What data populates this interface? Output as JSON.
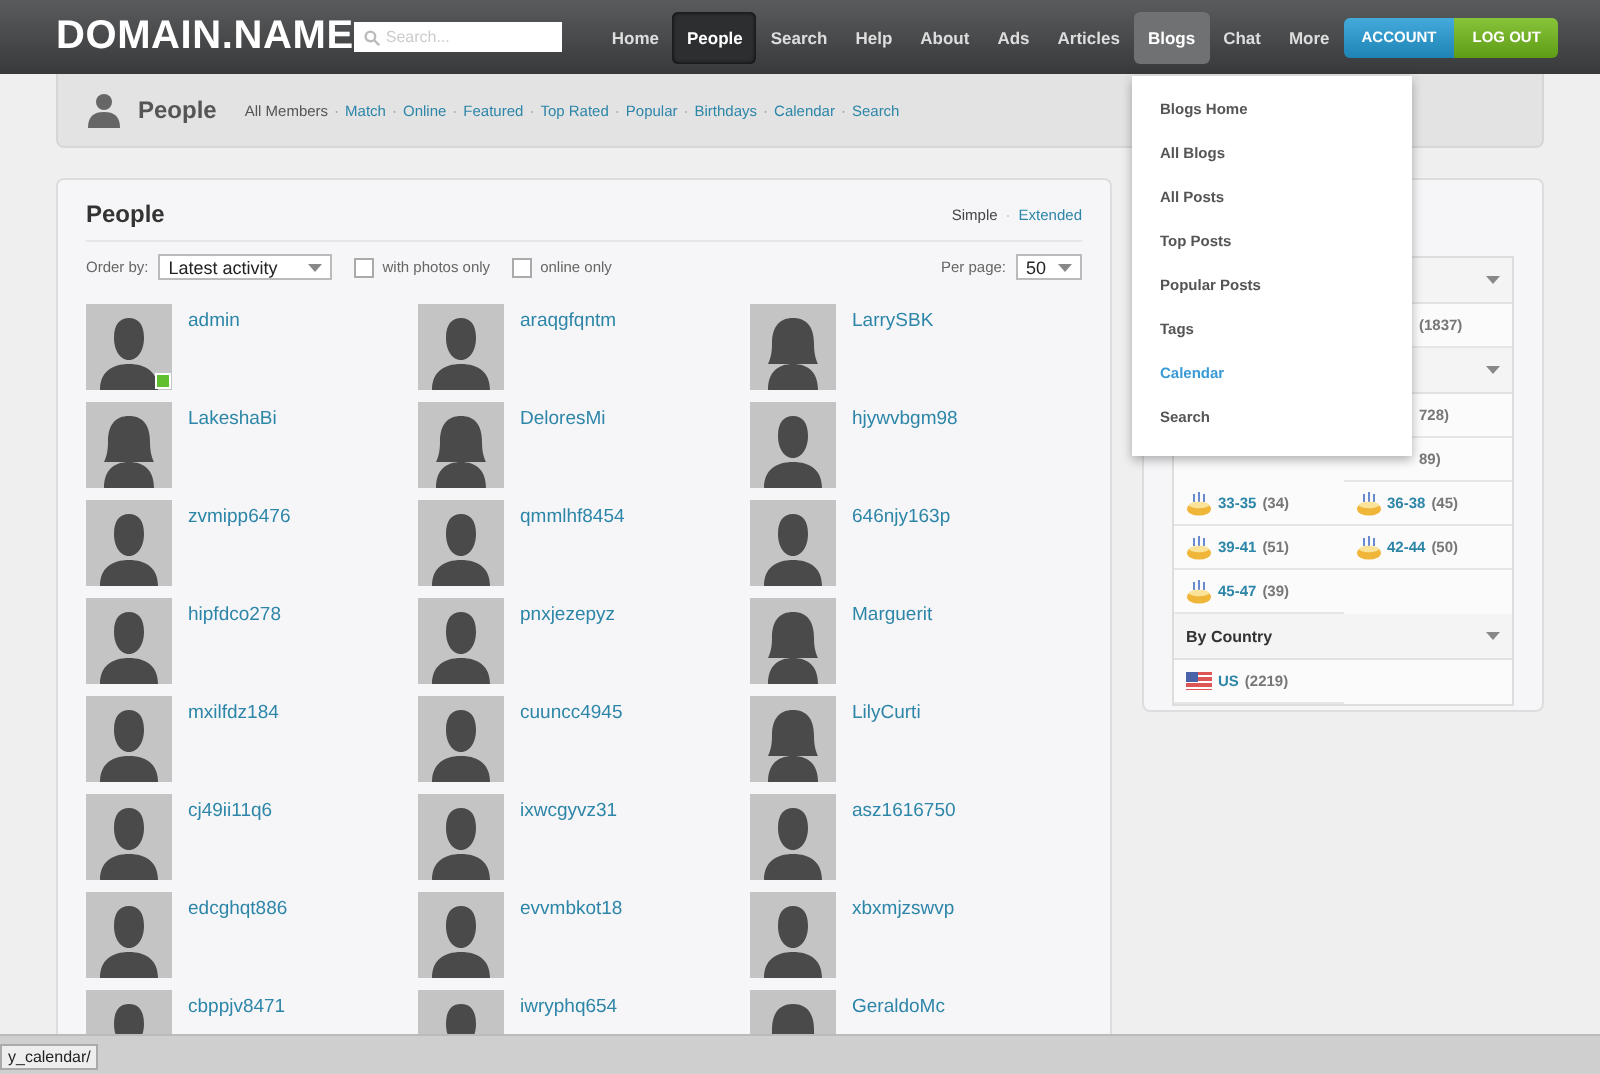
{
  "header": {
    "logo": "DOMAIN.NAME",
    "search": {
      "placeholder": "Search..."
    },
    "nav": [
      {
        "label": "Home",
        "selected": false,
        "expanded": false
      },
      {
        "label": "People",
        "selected": true,
        "expanded": false
      },
      {
        "label": "Search",
        "selected": false,
        "expanded": false
      },
      {
        "label": "Help",
        "selected": false,
        "expanded": false
      },
      {
        "label": "About",
        "selected": false,
        "expanded": false
      },
      {
        "label": "Ads",
        "selected": false,
        "expanded": false
      },
      {
        "label": "Articles",
        "selected": false,
        "expanded": false
      },
      {
        "label": "Blogs",
        "selected": false,
        "expanded": true
      },
      {
        "label": "Chat",
        "selected": false,
        "expanded": false
      },
      {
        "label": "More",
        "selected": false,
        "expanded": false
      }
    ],
    "buttons": [
      {
        "label": "ACCOUNT",
        "kind": "account"
      },
      {
        "label": "LOG OUT",
        "kind": "logout"
      }
    ]
  },
  "dropdown": [
    {
      "label": "Blogs Home",
      "highlighted": false
    },
    {
      "label": "All Blogs",
      "highlighted": false
    },
    {
      "label": "All Posts",
      "highlighted": false
    },
    {
      "label": "Top Posts",
      "highlighted": false
    },
    {
      "label": "Popular Posts",
      "highlighted": false
    },
    {
      "label": "Tags",
      "highlighted": false
    },
    {
      "label": "Calendar",
      "highlighted": true
    },
    {
      "label": "Search",
      "highlighted": false
    }
  ],
  "subheader": {
    "title": "People",
    "separator": "·",
    "links": [
      {
        "label": "All Members",
        "selected": true
      },
      {
        "label": "Match",
        "selected": false
      },
      {
        "label": "Online",
        "selected": false
      },
      {
        "label": "Featured",
        "selected": false
      },
      {
        "label": "Top Rated",
        "selected": false
      },
      {
        "label": "Popular",
        "selected": false
      },
      {
        "label": "Birthdays",
        "selected": false
      },
      {
        "label": "Calendar",
        "selected": false
      },
      {
        "label": "Search",
        "selected": false
      }
    ]
  },
  "people": {
    "title": "People",
    "views_separator": "·",
    "views": [
      {
        "label": "Simple",
        "selected": true
      },
      {
        "label": "Extended",
        "selected": false
      }
    ],
    "order_label": "Order by:",
    "order_value": "Latest activity",
    "filters": [
      {
        "label": "with photos only",
        "checked": false
      },
      {
        "label": "online only",
        "checked": false
      }
    ],
    "per_page_label": "Per page:",
    "per_page_value": "50",
    "members": [
      {
        "name": "admin",
        "kind": "male",
        "online": true
      },
      {
        "name": "araqgfqntm",
        "kind": "male",
        "online": false
      },
      {
        "name": "LarrySBK",
        "kind": "female",
        "online": false
      },
      {
        "name": "LakeshaBi",
        "kind": "female",
        "online": false
      },
      {
        "name": "DeloresMi",
        "kind": "female",
        "online": false
      },
      {
        "name": "hjywvbgm98",
        "kind": "male",
        "online": false
      },
      {
        "name": "zvmipp6476",
        "kind": "male",
        "online": false
      },
      {
        "name": "qmmlhf8454",
        "kind": "male",
        "online": false
      },
      {
        "name": "646njy163p",
        "kind": "male",
        "online": false
      },
      {
        "name": "hipfdco278",
        "kind": "male",
        "online": false
      },
      {
        "name": "pnxjezepyz",
        "kind": "male",
        "online": false
      },
      {
        "name": "Marguerit",
        "kind": "female",
        "online": false
      },
      {
        "name": "mxilfdz184",
        "kind": "male",
        "online": false
      },
      {
        "name": "cuuncc4945",
        "kind": "male",
        "online": false
      },
      {
        "name": "LilyCurti",
        "kind": "female",
        "online": false
      },
      {
        "name": "cj49ii11q6",
        "kind": "male",
        "online": false
      },
      {
        "name": "ixwcgyvz31",
        "kind": "male",
        "online": false
      },
      {
        "name": "asz1616750",
        "kind": "male",
        "online": false
      },
      {
        "name": "edcghqt886",
        "kind": "male",
        "online": false
      },
      {
        "name": "evvmbkot18",
        "kind": "male",
        "online": false
      },
      {
        "name": "xbxmjzswvp",
        "kind": "male",
        "online": false
      },
      {
        "name": "cbppjv8471",
        "kind": "male"
      },
      {
        "name": "iwryphq654",
        "kind": "male"
      },
      {
        "name": "GeraldoMc",
        "kind": "female"
      }
    ]
  },
  "browse": {
    "groups": [
      {
        "items": [
          {
            "count": "(1837)"
          }
        ]
      },
      {
        "items": [
          {
            "count": "728)"
          },
          {
            "count": "89)"
          },
          {
            "label": "33-35",
            "count": "(34)",
            "kind": "age"
          },
          {
            "label": "36-38",
            "count": "(45)",
            "kind": "age"
          },
          {
            "label": "39-41",
            "count": "(51)",
            "kind": "age"
          },
          {
            "label": "42-44",
            "count": "(50)",
            "kind": "age"
          },
          {
            "label": "45-47",
            "count": "(39)",
            "kind": "age"
          }
        ]
      },
      {
        "title": "By Country",
        "items": [
          {
            "label": "US",
            "count": "(2219)",
            "kind": "country"
          }
        ]
      }
    ]
  },
  "status_bar": {
    "url": "y_calendar/"
  }
}
